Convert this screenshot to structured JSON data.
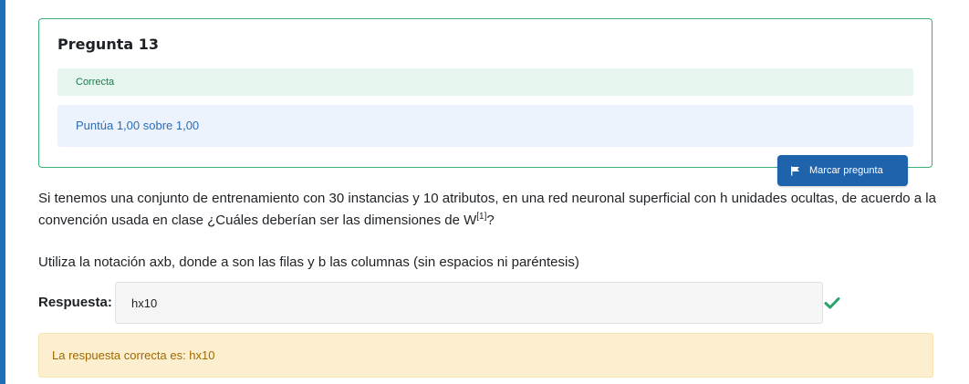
{
  "question": {
    "title": "Pregunta 13",
    "state": "Correcta",
    "grade": "Puntúa 1,00 sobre 1,00",
    "flag_label": "Marcar pregunta",
    "text_before": "Si tenemos una conjunto de entrenamiento con 30 instancias y 10 atributos, en una red neuronal superficial con h unidades ocultas, de acuerdo a la convención usada en clase ¿Cuáles deberían ser las dimensiones de W",
    "text_sup": "[1]",
    "text_after": "?",
    "note": "Utiliza la notación axb, donde a son las filas y b las columnas (sin espacios ni paréntesis)"
  },
  "answer": {
    "label": "Respuesta:",
    "value": "hx10",
    "status_icon": "check-icon"
  },
  "feedback": {
    "text": "La respuesta correcta es: hx10"
  },
  "colors": {
    "accent": "#1e63ab",
    "correct": "#3bb079",
    "feedback_bg": "#fcefd0"
  }
}
